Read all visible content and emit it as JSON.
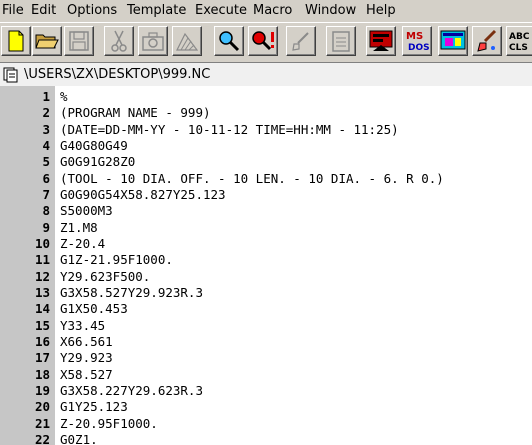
{
  "menu": [
    "File",
    "Edit",
    "Options",
    "Template",
    "Execute",
    "Macro",
    "Window",
    "Help"
  ],
  "toolbar": {
    "buttons": [
      "new-file",
      "open-folder",
      "save",
      "cut",
      "camera",
      "hatch",
      "find",
      "find-next",
      "brush",
      "clipboard",
      "program-flag",
      "ms-dos",
      "screen",
      "paint-brush",
      "abc-cls"
    ],
    "msdos_label_1": "MS",
    "msdos_label_2": "DOS",
    "abc_label": "ABC",
    "cls_label": "CLS"
  },
  "document": {
    "path": "\\USERS\\ZX\\DESKTOP\\999.NC"
  },
  "code": [
    {
      "n": "1",
      "text": "%"
    },
    {
      "n": "2",
      "text": "(PROGRAM NAME - 999)"
    },
    {
      "n": "3",
      "text": "(DATE=DD-MM-YY - 10-11-12 TIME=HH:MM - 11:25)"
    },
    {
      "n": "4",
      "text": "G40G80G49"
    },
    {
      "n": "5",
      "text": "G0G91G28Z0"
    },
    {
      "n": "6",
      "text": "(TOOL - 10 DIA. OFF. - 10 LEN. - 10 DIA. - 6. R 0.)"
    },
    {
      "n": "7",
      "text": "G0G90G54X58.827Y25.123"
    },
    {
      "n": "8",
      "text": "S5000M3"
    },
    {
      "n": "9",
      "text": "Z1.M8"
    },
    {
      "n": "10",
      "text": "Z-20.4"
    },
    {
      "n": "11",
      "text": "G1Z-21.95F1000."
    },
    {
      "n": "12",
      "text": "Y29.623F500."
    },
    {
      "n": "13",
      "text": "G3X58.527Y29.923R.3"
    },
    {
      "n": "14",
      "text": "G1X50.453"
    },
    {
      "n": "15",
      "text": "Y33.45"
    },
    {
      "n": "16",
      "text": "X66.561"
    },
    {
      "n": "17",
      "text": "Y29.923"
    },
    {
      "n": "18",
      "text": "X58.527"
    },
    {
      "n": "19",
      "text": "G3X58.227Y29.623R.3"
    },
    {
      "n": "20",
      "text": "G1Y25.123"
    },
    {
      "n": "21",
      "text": "Z-20.95F1000."
    },
    {
      "n": "22",
      "text": "G0Z1."
    }
  ]
}
